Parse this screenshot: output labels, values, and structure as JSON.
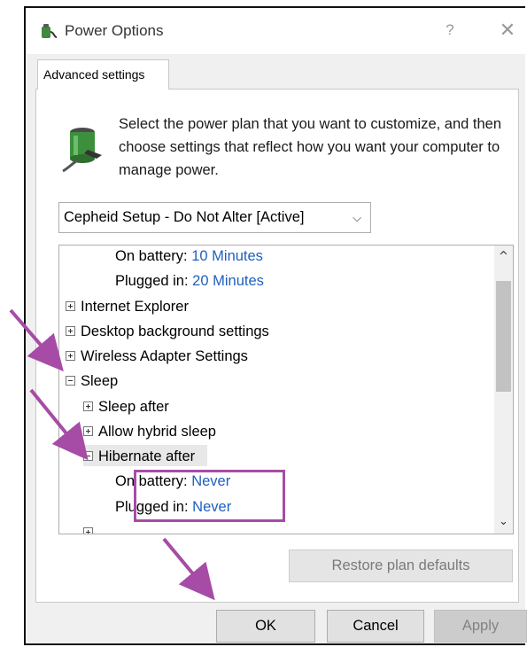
{
  "window": {
    "title": "Power Options",
    "help_label": "?",
    "close_label": "✕",
    "icon": "power-options-icon"
  },
  "tab": {
    "label": "Advanced settings"
  },
  "description": "Select the power plan that you want to customize, and then choose settings that reflect how you want your computer to manage power.",
  "plan_select": {
    "value": "Cepheid Setup - Do Not Alter [Active]",
    "chevron": "⌵"
  },
  "tree": {
    "items": [
      {
        "label": "On battery:",
        "value": "10 Minutes"
      },
      {
        "label": "Plugged in:",
        "value": "20 Minutes"
      },
      {
        "label": "Internet Explorer"
      },
      {
        "label": "Desktop background settings"
      },
      {
        "label": "Wireless Adapter Settings"
      },
      {
        "label": "Sleep"
      },
      {
        "label": "Sleep after"
      },
      {
        "label": "Allow hybrid sleep"
      },
      {
        "label": "Hibernate after"
      },
      {
        "label": "On battery:",
        "value": "Never"
      },
      {
        "label": "Plugged in:",
        "value": "Never"
      }
    ],
    "scroll_up": "^",
    "scroll_down": "⌄"
  },
  "buttons": {
    "restore": "Restore plan defaults",
    "ok": "OK",
    "cancel": "Cancel",
    "apply": "Apply"
  },
  "colors": {
    "annotation": "#a64ca6",
    "link_value": "#1f5fbf"
  }
}
